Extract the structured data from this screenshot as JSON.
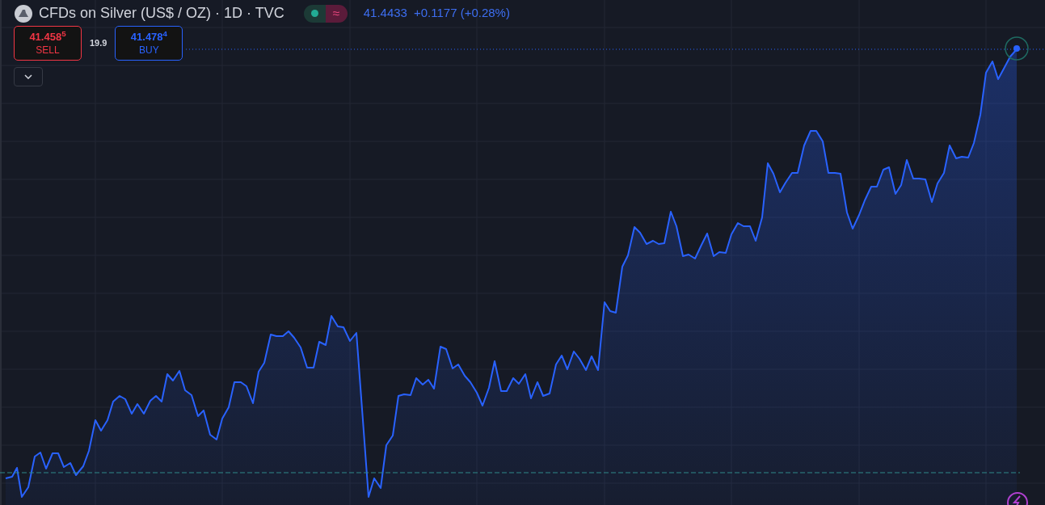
{
  "legend": {
    "title": "CFDs on Silver (US$ / OZ) · 1D · TVC",
    "market_open": true,
    "delay_mark": "≈",
    "last": "41.4433",
    "change": "+0.1177",
    "change_pct": "(+0.28%)"
  },
  "trade": {
    "sell": {
      "price": "41.458$^{5}$",
      "label": "SELL"
    },
    "spread": "19.9",
    "buy": {
      "price": "41.478$^{4}$",
      "label": "BUY"
    }
  }
}
